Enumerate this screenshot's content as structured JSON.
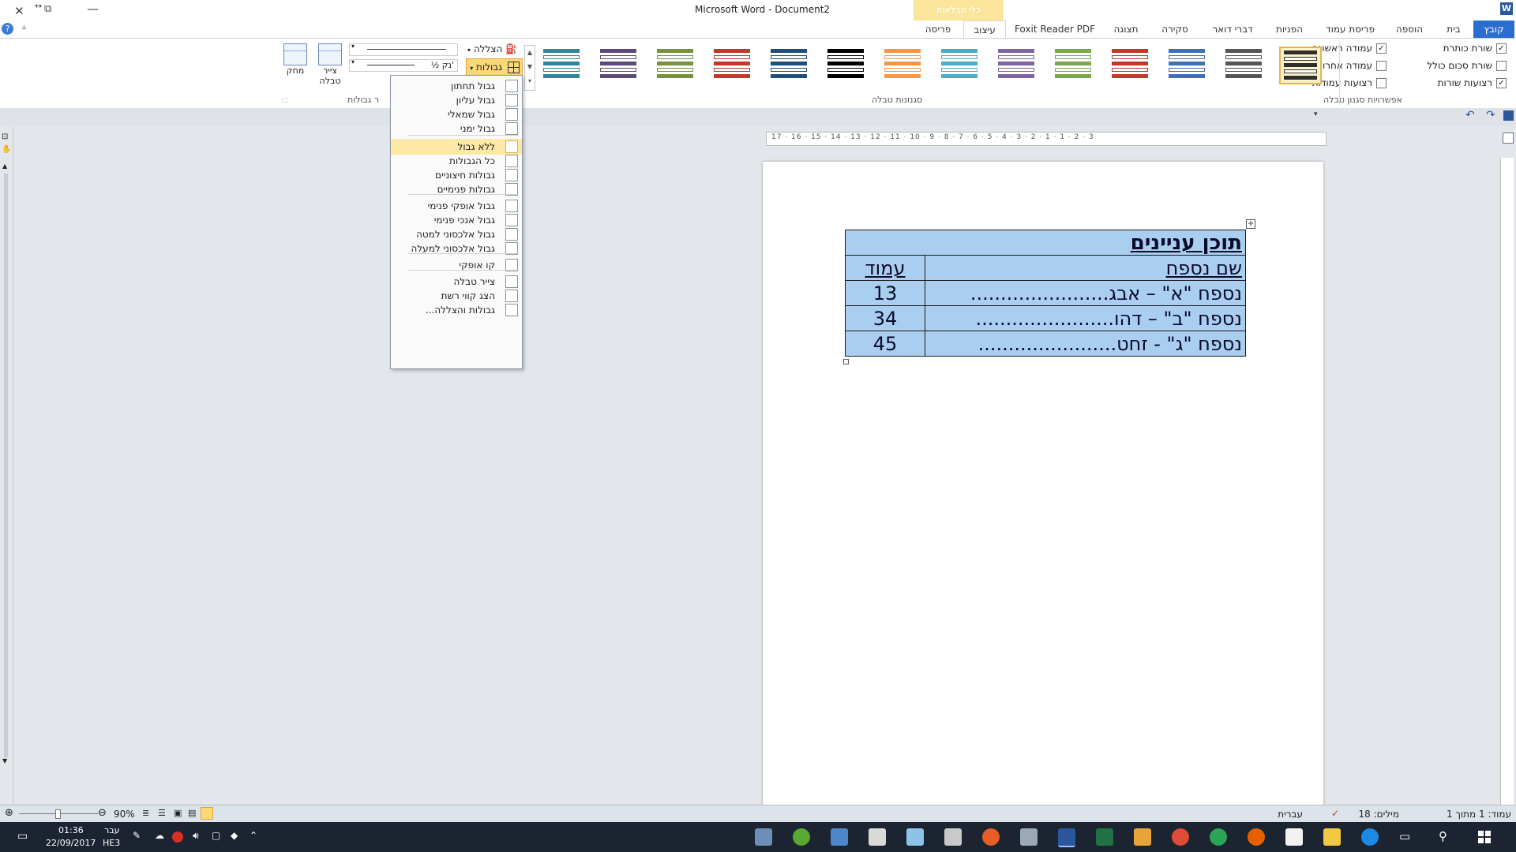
{
  "window": {
    "app_title": "Microsoft Word",
    "doc_title": "Document2",
    "contextual_tab_group": "כלי טבלאות"
  },
  "tabs": [
    "קובץ",
    "בית",
    "הוספה",
    "פריסת עמוד",
    "הפניות",
    "דברי דואר",
    "סקירה",
    "תצוגה",
    "Foxit Reader PDF",
    "עיצוב",
    "פריסה"
  ],
  "ribbon": {
    "options_group_label": "אפשרויות סגנון טבלה",
    "styles_group_label": "סגנונות טבלה",
    "borders_group_label": "ר גבולות",
    "options": [
      {
        "label": "שורת כותרת",
        "checked": "✓"
      },
      {
        "label": "שורת סכום כולל",
        "checked": ""
      },
      {
        "label": "רצועות שורות",
        "checked": "✓"
      },
      {
        "label": "עמודה ראשונה",
        "checked": "✓"
      },
      {
        "label": "עמודה אחרונה",
        "checked": ""
      },
      {
        "label": "רצועות עמודות",
        "checked": ""
      }
    ],
    "shading_label": "הצללה",
    "borders_label": "גבולות",
    "pen_weight": "½ נק'",
    "draw_table_label": "צייר טבלה",
    "eraser_label": "מחק",
    "style_colors": [
      "#2e2e2e",
      "#555",
      "#3f6fb5",
      "#c0392b",
      "#7aa84a",
      "#8064a2",
      "#4bacc6",
      "#f79646",
      "#000",
      "#1f4e79",
      "#c0392b",
      "#76923c",
      "#5f497a",
      "#31849b"
    ]
  },
  "menu": {
    "items": [
      {
        "label": "גבול תחתון",
        "icon": "bottom-border-icon"
      },
      {
        "label": "גבול עליון",
        "icon": "top-border-icon"
      },
      {
        "label": "גבול שמאלי",
        "icon": "left-border-icon"
      },
      {
        "label": "גבול ימני",
        "icon": "right-border-icon"
      },
      {
        "label": "ללא גבול",
        "icon": "no-border-icon",
        "selected": true
      },
      {
        "label": "כל הגבולות",
        "icon": "all-borders-icon"
      },
      {
        "label": "גבולות חיצוניים",
        "icon": "outside-borders-icon"
      },
      {
        "label": "גבולות פנימיים",
        "icon": "inside-borders-icon"
      },
      {
        "label": "גבול אופקי פנימי",
        "icon": "inside-horizontal-border-icon"
      },
      {
        "label": "גבול אנכי פנימי",
        "icon": "inside-vertical-border-icon"
      },
      {
        "label": "גבול אלכסוני למטה",
        "icon": "diagonal-down-border-icon"
      },
      {
        "label": "גבול אלכסוני למעלה",
        "icon": "diagonal-up-border-icon"
      },
      {
        "label": "קו אופקי",
        "icon": "horizontal-line-icon"
      },
      {
        "label": "צייר טבלה",
        "icon": "draw-table-icon"
      },
      {
        "label": "הצג קווי רשת",
        "icon": "gridlines-icon"
      },
      {
        "label": "גבולות והצללה...",
        "icon": "borders-shading-icon"
      }
    ]
  },
  "document": {
    "toc_title": "תוכן עניינים",
    "header_name": "שם נספח",
    "header_page": "עמוד",
    "rows": [
      {
        "name": "נספח \"א\" – אבג.......................",
        "page": "13"
      },
      {
        "name": "נספח \"ב\" – דהו.......................",
        "page": "34"
      },
      {
        "name": "נספח \"ג\" - זחט.......................",
        "page": "45"
      }
    ]
  },
  "ruler_numbers": "3 · 2 · 1 · 1 · 2 · 3 · 4 · 5 · 6 · 7 · 8 · 9 · 10 · 11 · 12 · 13 · 14 · 15 · 16 · 17",
  "status": {
    "page": "עמוד: 1 מתוך 1",
    "words": "מילים: 18",
    "language": "עברית",
    "zoom": "90%"
  },
  "taskbar": {
    "time": "01:36",
    "date": "22/09/2017",
    "lang": "עבר",
    "lang2": "HE3"
  }
}
